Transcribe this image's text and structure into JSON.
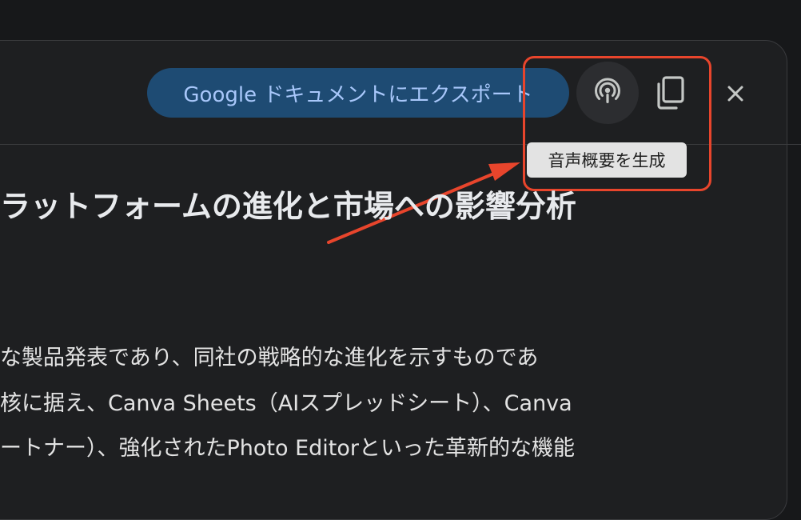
{
  "header": {
    "export_label": "Google ドキュメントにエクスポート",
    "tooltip": "音声概要を生成"
  },
  "icons": {
    "podcast": "podcast-icon",
    "copy": "copy-icon",
    "close": "close-icon"
  },
  "document": {
    "title": "ラットフォームの進化と市場への影響分析",
    "lines": [
      "な製品発表であり、同社の戦略的な進化を示すものであ",
      "核に据え、Canva Sheets（AIスプレッドシート）、Canva",
      "ートナー）、強化されたPhoto Editorといった革新的な機能"
    ]
  },
  "colors": {
    "background": "#17181a",
    "panel": "#1e1f21",
    "export_button": "#1e4b73",
    "export_text": "#a8c7fa",
    "annotation": "#e8452c",
    "tooltip_bg": "#e3e3e3"
  }
}
